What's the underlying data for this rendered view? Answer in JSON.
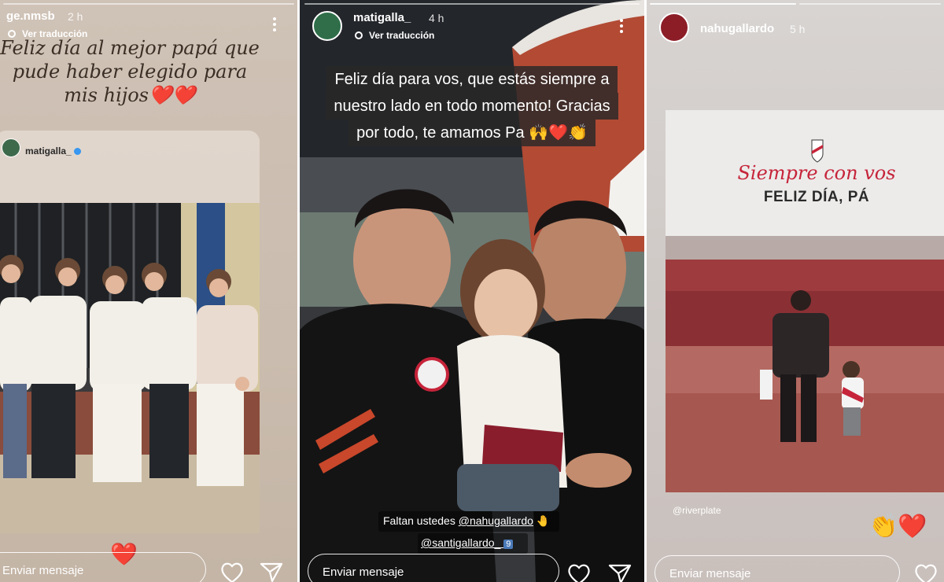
{
  "stories": [
    {
      "username": "ge.nmsb",
      "time": "2 h",
      "translate_label": "Ver traducción",
      "caption": "Feliz día al mejor papá que pude haber elegido para mis hijos",
      "caption_emoji": "❤️❤️",
      "repost_username": "matigalla_",
      "reaction_emoji": "❤️",
      "reply_placeholder": "Enviar mensaje"
    },
    {
      "username": "matigalla_",
      "time": "4 h",
      "translate_label": "Ver traducción",
      "caption_lines": [
        "Feliz día para vos, que estás siempre a",
        "nuestro lado en todo momento! Gracias",
        "por todo, te amamos Pa 🙌❤️👏"
      ],
      "mention_prefix": "Faltan ustedes",
      "mentions": [
        "@nahugallardo",
        "@santigallardo_"
      ],
      "mention_emoji_1": "🤚",
      "mention_emoji_2": "9",
      "reply_placeholder": "Enviar mensaje"
    },
    {
      "username": "nahugallardo",
      "time": "5 h",
      "promo_script": "Siempre con vos",
      "promo_title": "FELIZ DÍA, PÁ",
      "credit": "@riverplate",
      "reactions": "👏❤️",
      "reply_placeholder": "Enviar mensaje"
    }
  ],
  "colors": {
    "river_red": "#c6243a",
    "ig_blue": "#3897f0"
  }
}
